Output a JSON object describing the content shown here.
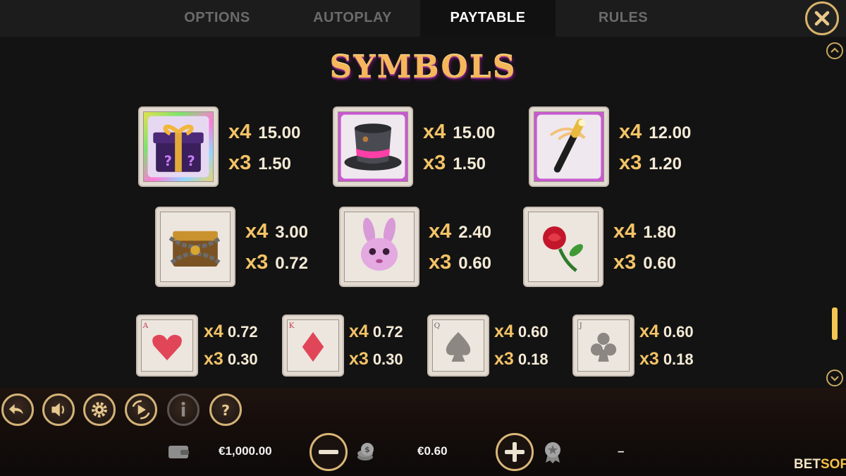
{
  "tabs": [
    {
      "label": "OPTIONS"
    },
    {
      "label": "AUTOPLAY"
    },
    {
      "label": "PAYTABLE",
      "active": true
    },
    {
      "label": "RULES"
    }
  ],
  "title": "SYMBOLS",
  "symbols": [
    {
      "icon": "mystery-gift-icon",
      "x4": "x4",
      "v4": "15.00",
      "x3": "x3",
      "v3": "1.50"
    },
    {
      "icon": "top-hat-icon",
      "x4": "x4",
      "v4": "15.00",
      "x3": "x3",
      "v3": "1.50"
    },
    {
      "icon": "magic-wand-icon",
      "x4": "x4",
      "v4": "12.00",
      "x3": "x3",
      "v3": "1.20"
    },
    {
      "icon": "chained-chest-icon",
      "x4": "x4",
      "v4": "3.00",
      "x3": "x3",
      "v3": "0.72"
    },
    {
      "icon": "bunny-icon",
      "x4": "x4",
      "v4": "2.40",
      "x3": "x3",
      "v3": "0.60"
    },
    {
      "icon": "rose-icon",
      "x4": "x4",
      "v4": "1.80",
      "x3": "x3",
      "v3": "0.60"
    },
    {
      "icon": "ace-hearts-card-icon",
      "corner": "A",
      "x4": "x4",
      "v4": "0.72",
      "x3": "x3",
      "v3": "0.30"
    },
    {
      "icon": "king-diamonds-card-icon",
      "corner": "K",
      "x4": "x4",
      "v4": "0.72",
      "x3": "x3",
      "v3": "0.30"
    },
    {
      "icon": "queen-spades-card-icon",
      "corner": "Q",
      "x4": "x4",
      "v4": "0.60",
      "x3": "x3",
      "v3": "0.18"
    },
    {
      "icon": "jack-clubs-card-icon",
      "corner": "J",
      "x4": "x4",
      "v4": "0.60",
      "x3": "x3",
      "v3": "0.18"
    }
  ],
  "controls": [
    "back-icon",
    "sound-icon",
    "settings-icon",
    "autoplay-icon",
    "info-icon",
    "help-icon"
  ],
  "bottom": {
    "balance": "€1,000.00",
    "bet": "€0.60",
    "win": "–",
    "logo_left": "BET",
    "logo_right": "SOFT"
  },
  "colors": {
    "accent_gold": "#d8b36a",
    "multiplier": "#f3c366",
    "title": "#f5b75a",
    "background": "#131313"
  }
}
